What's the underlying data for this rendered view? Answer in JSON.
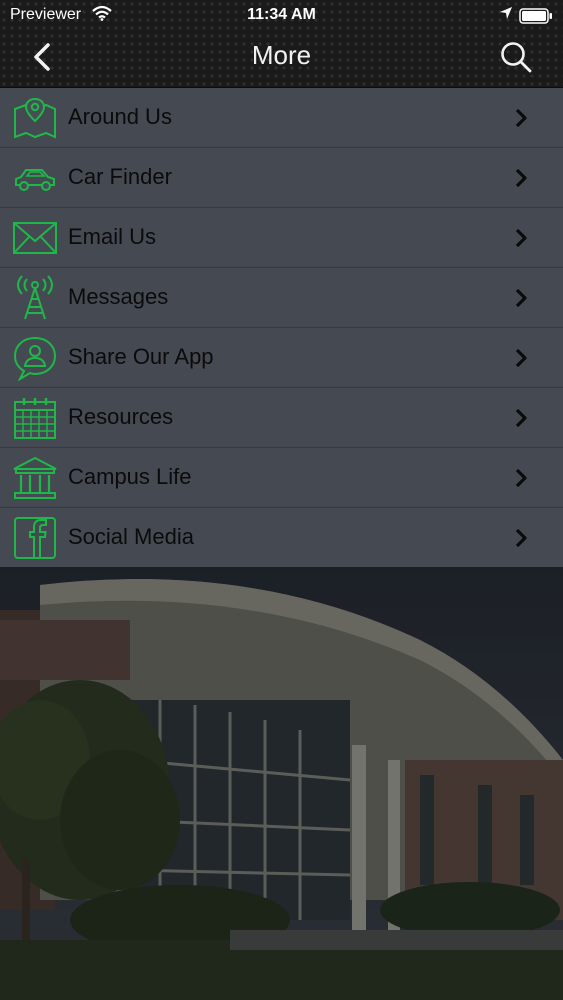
{
  "status_bar": {
    "carrier": "Previewer",
    "time": "11:34 AM"
  },
  "header": {
    "title": "More"
  },
  "menu": {
    "items": [
      {
        "label": "Around Us",
        "icon": "map-pin-icon"
      },
      {
        "label": "Car Finder",
        "icon": "car-icon"
      },
      {
        "label": "Email Us",
        "icon": "envelope-icon"
      },
      {
        "label": "Messages",
        "icon": "antenna-icon"
      },
      {
        "label": "Share Our App",
        "icon": "share-chat-icon"
      },
      {
        "label": "Resources",
        "icon": "calendar-icon"
      },
      {
        "label": "Campus Life",
        "icon": "building-columns-icon"
      },
      {
        "label": "Social Media",
        "icon": "facebook-icon"
      }
    ]
  },
  "colors": {
    "accent": "#1fb848",
    "menu_bg": "#484e56",
    "header_bg": "#1a1a1a",
    "label_text": "#0b0b0b"
  }
}
